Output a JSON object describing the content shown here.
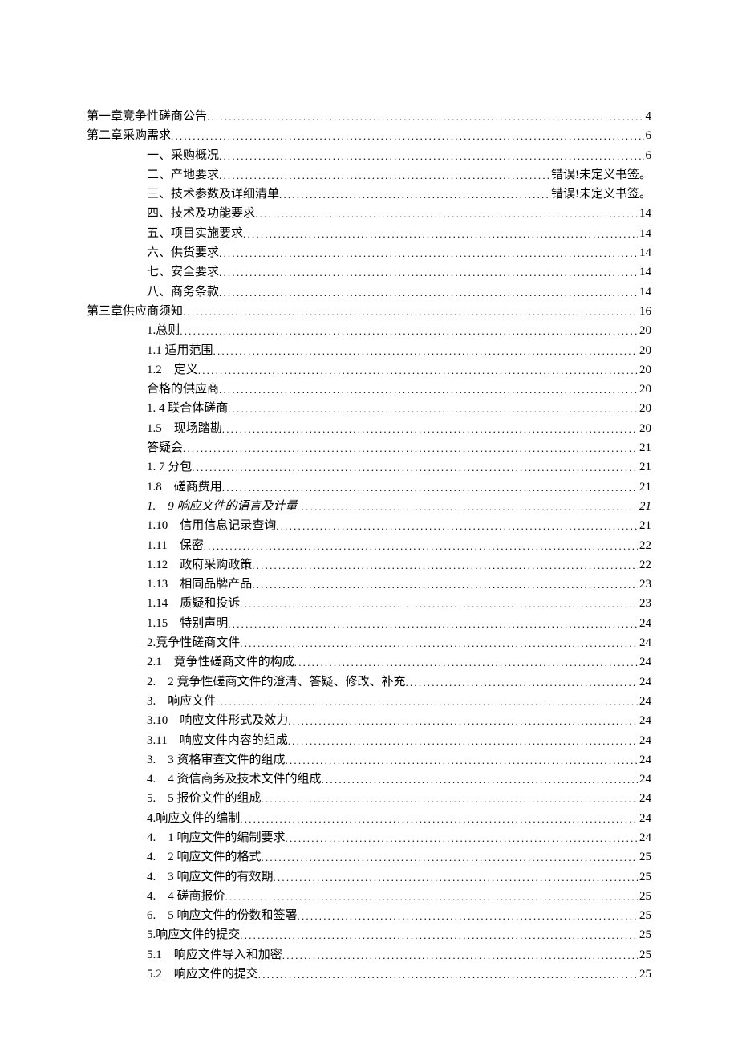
{
  "toc": [
    {
      "indent": 0,
      "label": "第一章竞争性磋商公告",
      "page": "4",
      "italic": false
    },
    {
      "indent": 0,
      "label": "第二章采购需求",
      "page": "6",
      "italic": false
    },
    {
      "indent": 1,
      "label": "一、采购概况",
      "page": "6",
      "italic": false
    },
    {
      "indent": 1,
      "label": "二、产地要求",
      "page": "错误!未定义书签。",
      "italic": false
    },
    {
      "indent": 1,
      "label": "三、技术参数及详细清单",
      "page": "错误!未定义书签。",
      "italic": false
    },
    {
      "indent": 1,
      "label": "四、技术及功能要求",
      "page": "14",
      "italic": false
    },
    {
      "indent": 1,
      "label": "五、项目实施要求",
      "page": "14",
      "italic": false
    },
    {
      "indent": 1,
      "label": "六、供货要求",
      "page": "14",
      "italic": false
    },
    {
      "indent": 1,
      "label": "七、安全要求",
      "page": "14",
      "italic": false
    },
    {
      "indent": 1,
      "label": "八、商务条款",
      "page": "14",
      "italic": false
    },
    {
      "indent": 0,
      "label": "第三章供应商须知",
      "page": "16",
      "italic": false
    },
    {
      "indent": 1,
      "label": "1.总则",
      "page": "20",
      "italic": false
    },
    {
      "indent": 1,
      "label": "1.1 适用范围",
      "page": "20",
      "italic": false
    },
    {
      "indent": 1,
      "label": "1.2　定义",
      "page": "20",
      "italic": false
    },
    {
      "indent": 1,
      "label": "合格的供应商",
      "page": "20",
      "italic": false
    },
    {
      "indent": 1,
      "label": "1. 4 联合体磋商",
      "page": "20",
      "italic": false
    },
    {
      "indent": 1,
      "label": "1.5　现场踏勘",
      "page": "20",
      "italic": false
    },
    {
      "indent": 1,
      "label": "答疑会",
      "page": "21",
      "italic": false
    },
    {
      "indent": 1,
      "label": "1. 7 分包",
      "page": "21",
      "italic": false
    },
    {
      "indent": 1,
      "label": "1.8　磋商费用",
      "page": "21",
      "italic": false
    },
    {
      "indent": 1,
      "label": "1.　9 响应文件的语言及计量",
      "page": "21",
      "italic": true
    },
    {
      "indent": 1,
      "label": "1.10　信用信息记录查询",
      "page": "21",
      "italic": false
    },
    {
      "indent": 1,
      "label": "1.11　保密",
      "page": "22",
      "italic": false
    },
    {
      "indent": 1,
      "label": "1.12　政府采购政策",
      "page": "22",
      "italic": false
    },
    {
      "indent": 1,
      "label": "1.13　相同品牌产品",
      "page": "23",
      "italic": false
    },
    {
      "indent": 1,
      "label": "1.14　质疑和投诉",
      "page": "23",
      "italic": false
    },
    {
      "indent": 1,
      "label": "1.15　特别声明",
      "page": "24",
      "italic": false
    },
    {
      "indent": 1,
      "label": "2.竞争性磋商文件",
      "page": "24",
      "italic": false
    },
    {
      "indent": 1,
      "label": "2.1　竞争性磋商文件的构成",
      "page": "24",
      "italic": false
    },
    {
      "indent": 1,
      "label": "2.　2 竞争性磋商文件的澄清、答疑、修改、补充",
      "page": "24",
      "italic": false
    },
    {
      "indent": 1,
      "label": "3.　响应文件",
      "page": "24",
      "italic": false
    },
    {
      "indent": 1,
      "label": "3.10　响应文件形式及效力",
      "page": "24",
      "italic": false
    },
    {
      "indent": 1,
      "label": "3.11　响应文件内容的组成",
      "page": "24",
      "italic": false
    },
    {
      "indent": 1,
      "label": "3.　3 资格审查文件的组成",
      "page": "24",
      "italic": false
    },
    {
      "indent": 1,
      "label": "4.　4 资信商务及技术文件的组成",
      "page": "24",
      "italic": false
    },
    {
      "indent": 1,
      "label": "5.　5 报价文件的组成",
      "page": "24",
      "italic": false
    },
    {
      "indent": 1,
      "label": "4.响应文件的编制",
      "page": "24",
      "italic": false
    },
    {
      "indent": 1,
      "label": "4.　1 响应文件的编制要求",
      "page": "24",
      "italic": false
    },
    {
      "indent": 1,
      "label": "4.　2 响应文件的格式",
      "page": "25",
      "italic": false
    },
    {
      "indent": 1,
      "label": "4.　3 响应文件的有效期",
      "page": "25",
      "italic": false
    },
    {
      "indent": 1,
      "label": "4.　4 磋商报价",
      "page": "25",
      "italic": false
    },
    {
      "indent": 1,
      "label": "6.　5 响应文件的份数和签署",
      "page": "25",
      "italic": false
    },
    {
      "indent": 1,
      "label": "5.响应文件的提交",
      "page": "25",
      "italic": false
    },
    {
      "indent": 1,
      "label": "5.1　响应文件导入和加密",
      "page": "25",
      "italic": false
    },
    {
      "indent": 1,
      "label": "5.2　响应文件的提交",
      "page": "25",
      "italic": false
    }
  ]
}
